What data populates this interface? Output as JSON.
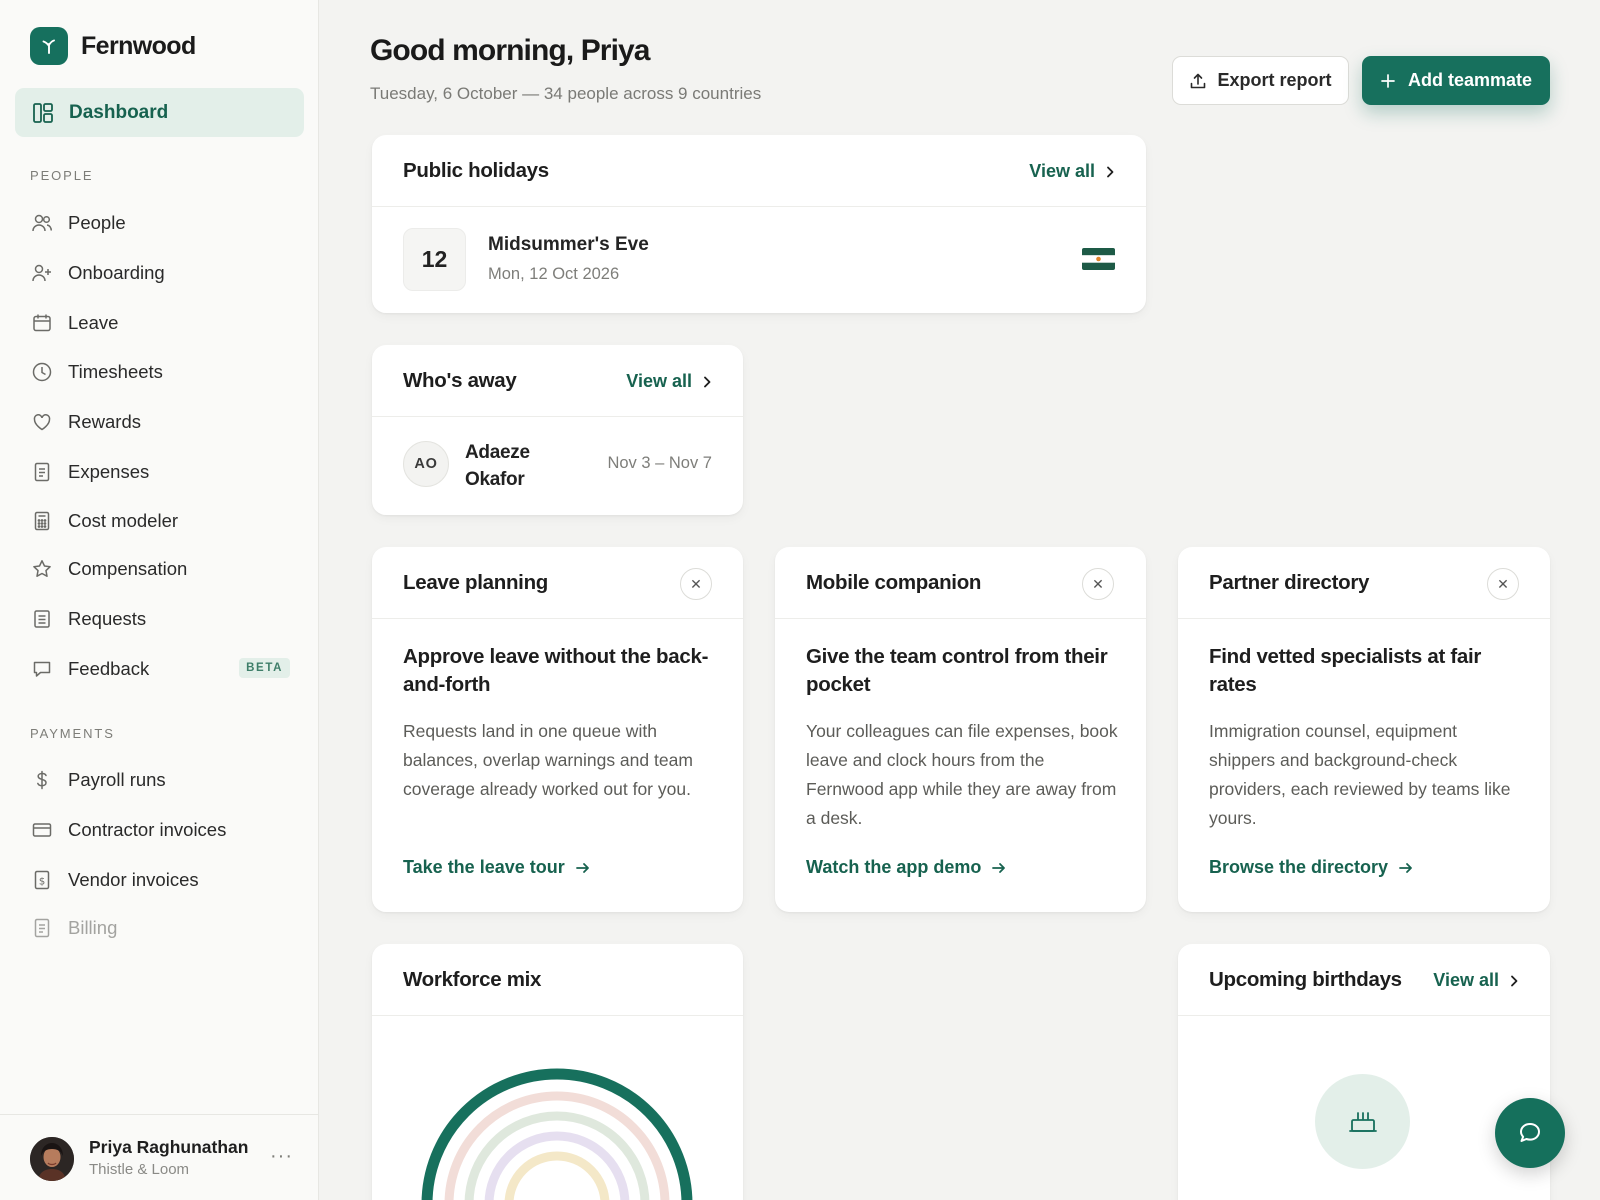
{
  "brand": {
    "name": "Fernwood"
  },
  "sidebar": {
    "active": {
      "label": "Dashboard",
      "icon": "dashboard-icon"
    },
    "people_section": "PEOPLE",
    "people_items": [
      {
        "label": "People",
        "icon": "users-icon"
      },
      {
        "label": "Onboarding",
        "icon": "user-plus-icon"
      },
      {
        "label": "Leave",
        "icon": "calendar-icon"
      },
      {
        "label": "Timesheets",
        "icon": "clock-icon"
      },
      {
        "label": "Rewards",
        "icon": "heart-icon"
      },
      {
        "label": "Expenses",
        "icon": "receipt-icon"
      },
      {
        "label": "Cost modeler",
        "icon": "calculator-icon"
      },
      {
        "label": "Compensation",
        "icon": "star-icon"
      },
      {
        "label": "Requests",
        "icon": "document-icon"
      },
      {
        "label": "Feedback",
        "icon": "message-icon",
        "badge": "BETA"
      }
    ],
    "payments_section": "PAYMENTS",
    "payment_items": [
      {
        "label": "Payroll runs",
        "icon": "dollar-icon"
      },
      {
        "label": "Contractor invoices",
        "icon": "credit-card-icon"
      },
      {
        "label": "Vendor invoices",
        "icon": "invoice-icon"
      },
      {
        "label": "Billing",
        "icon": "bill-icon",
        "disabled": true
      }
    ],
    "user": {
      "name": "Priya Raghunathan",
      "org": "Thistle & Loom",
      "more": "···"
    }
  },
  "header": {
    "greeting": "Good morning, Priya",
    "subline": "Tuesday, 6 October — 34 people across 9 countries",
    "export_label": "Export report",
    "add_label": "Add teammate"
  },
  "holidays": {
    "title": "Public holidays",
    "view_all": "View all",
    "item": {
      "day": "12",
      "name": "Midsummer's Eve",
      "date": "Mon, 12 Oct 2026",
      "flag": "india-flag-icon"
    }
  },
  "away": {
    "title": "Who's away",
    "view_all": "View all",
    "item": {
      "initials": "AO",
      "name": "Adaeze Okafor",
      "dates": "Nov 3 – Nov 7"
    }
  },
  "promos": [
    {
      "title": "Leave planning",
      "heading": "Approve leave without the back-and-forth",
      "body": "Requests land in one queue with balances, overlap warnings and team coverage already worked out for you.",
      "cta": "Take the leave tour"
    },
    {
      "title": "Mobile companion",
      "heading": "Give the team control from their pocket",
      "body": "Your colleagues can file expenses, book leave and clock hours from the Fernwood app while they are away from a desk.",
      "cta": "Watch the app demo"
    },
    {
      "title": "Partner directory",
      "heading": "Find vetted specialists at fair rates",
      "body": "Immigration counsel, equipment shippers and background-check providers, each reviewed by teams like yours.",
      "cta": "Browse the directory"
    }
  ],
  "workforce": {
    "title": "Workforce mix"
  },
  "birthdays": {
    "title": "Upcoming birthdays",
    "view_all": "View all"
  },
  "colors": {
    "accent": "#17705d",
    "accent_text": "#17624f",
    "accent_soft": "#e3efe9"
  }
}
